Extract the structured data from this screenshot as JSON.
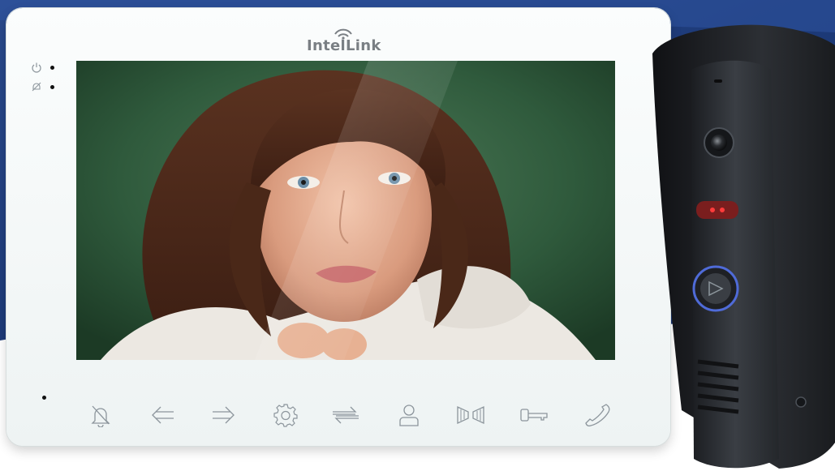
{
  "brand": {
    "name": "IntelLink"
  },
  "colors": {
    "background_wave": "#1f3b78",
    "monitor_body": "#f3f7f7",
    "icon_stroke": "#8c959c",
    "door_station_body": "#2b2e33",
    "indicator_red": "#ff3b3b",
    "button_ring": "#4f6bd8"
  },
  "monitor": {
    "indicators": [
      {
        "icon": "power-icon"
      },
      {
        "icon": "mute-bell-icon"
      }
    ],
    "buttons": [
      {
        "icon": "bell-mute-icon"
      },
      {
        "icon": "arrow-left-icon"
      },
      {
        "icon": "arrow-right-icon"
      },
      {
        "icon": "gear-icon"
      },
      {
        "icon": "transfer-icon"
      },
      {
        "icon": "user-icon"
      },
      {
        "icon": "gate-icon"
      },
      {
        "icon": "key-icon"
      },
      {
        "icon": "phone-handset-icon"
      }
    ]
  },
  "door_station": {
    "parts": [
      "rain-hood",
      "camera-lens",
      "infrared-led",
      "call-button",
      "speaker-grille",
      "tamper-screw"
    ]
  }
}
